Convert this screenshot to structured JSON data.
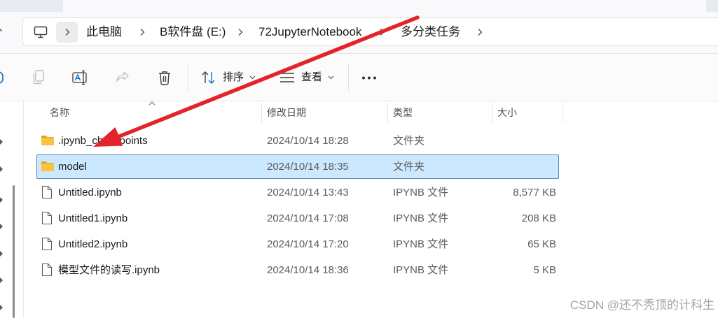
{
  "colors": {
    "accent": "#0f6cbd",
    "selection_background": "#cce8ff",
    "selection_border": "#5a86b9",
    "folder": "#f9c440",
    "annotation_arrow": "#e3242b",
    "watermark": "#a3a3a3"
  },
  "address_bar": {
    "location_icon": "monitor-icon",
    "expand_icon": "chevron-right-icon",
    "separator_icon": "chevron-right-icon",
    "breadcrumb": [
      "此电脑",
      "B软件盘 (E:)",
      "72JupyterNotebook",
      "多分类任务"
    ]
  },
  "toolbar": {
    "buttons": [
      {
        "icon": "copy-icon",
        "enabled": false
      },
      {
        "icon": "rename-icon",
        "enabled": true
      },
      {
        "icon": "share-icon",
        "enabled": false
      },
      {
        "icon": "delete-icon",
        "enabled": true
      }
    ],
    "sort": {
      "icon": "sort-icon",
      "label": "排序",
      "dropdown_icon": "chevron-down-icon"
    },
    "view": {
      "icon": "view-icon",
      "label": "查看",
      "dropdown_icon": "chevron-down-icon"
    },
    "more_icon": "more-icon"
  },
  "columns": {
    "name": "名称",
    "modified": "修改日期",
    "type": "类型",
    "size": "大小",
    "sort_icon": "chevron-up-icon"
  },
  "files": [
    {
      "icon": "folder-icon",
      "name": ".ipynb_checkpoints",
      "modified": "2024/10/14 18:28",
      "type": "文件夹",
      "size": "",
      "selected": false
    },
    {
      "icon": "folder-icon",
      "name": "model",
      "modified": "2024/10/14 18:35",
      "type": "文件夹",
      "size": "",
      "selected": true
    },
    {
      "icon": "file-icon",
      "name": "Untitled.ipynb",
      "modified": "2024/10/14 13:43",
      "type": "IPYNB 文件",
      "size": "8,577 KB",
      "selected": false
    },
    {
      "icon": "file-icon",
      "name": "Untitled1.ipynb",
      "modified": "2024/10/14 17:08",
      "type": "IPYNB 文件",
      "size": "208 KB",
      "selected": false
    },
    {
      "icon": "file-icon",
      "name": "Untitled2.ipynb",
      "modified": "2024/10/14 17:20",
      "type": "IPYNB 文件",
      "size": "65 KB",
      "selected": false
    },
    {
      "icon": "file-icon",
      "name": "模型文件的读写.ipynb",
      "modified": "2024/10/14 18:36",
      "type": "IPYNB 文件",
      "size": "5 KB",
      "selected": false
    }
  ],
  "annotation": {
    "icon": "red-arrow-icon"
  },
  "watermark": "CSDN @还不秃顶的计科生"
}
